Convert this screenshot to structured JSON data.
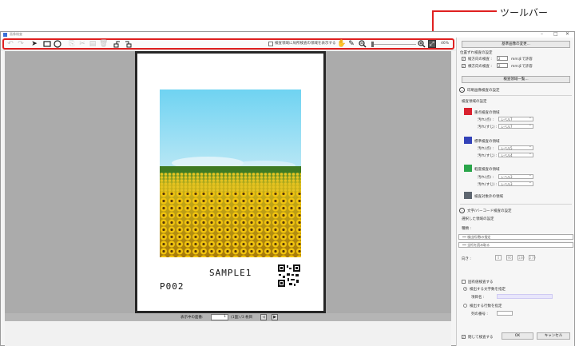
{
  "callout": {
    "label": "ツールバー"
  },
  "window": {
    "title": "画像検査",
    "controls": {
      "minimize": "–",
      "maximize": "□",
      "close": "✕"
    }
  },
  "toolbar": {
    "icons": [
      "undo-icon",
      "redo-icon",
      "select-arrow-icon",
      "rectangle-icon",
      "ellipse-icon",
      "copy-icon",
      "cut-icon",
      "paste-icon",
      "delete-icon",
      "rotate-left-icon",
      "rotate-right-icon"
    ],
    "show_areas_label": "検査領域に局所検査の領域を表示する",
    "zoom_percent": "46%"
  },
  "document": {
    "sample_text": "SAMPLE1",
    "page_code": "P002"
  },
  "pager": {
    "label": "表示中の面番:",
    "current": "1",
    "rest": "(1面) /3 枚目",
    "prev": "◀",
    "next": "▶"
  },
  "panel": {
    "ref_button": "基準画像の変更...",
    "print_pos_heading": "位置ずれ検査の設定",
    "vertical_label": "縦方向の検査 :",
    "vertical_value": "2",
    "horizontal_label": "横方向の検査 :",
    "horizontal_value": "2",
    "unit_suffix": "mmまで許容",
    "list_button": "検査領域一覧...",
    "print_area_heading": "印刷画像検査の設定",
    "color_heading": "検査領域の設定",
    "areas": [
      {
        "name": "重点検査の領域",
        "color": "#d9222f",
        "row1_label": "汚れ(点) :",
        "row1_value": "レベル7",
        "row2_label": "汚れ(すじ) :",
        "row2_value": "レベル7"
      },
      {
        "name": "標準検査の領域",
        "color": "#3342b8",
        "row1_label": "汚れ(点) :",
        "row1_value": "レベル5",
        "row2_label": "汚れ(すじ) :",
        "row2_value": "レベル4"
      },
      {
        "name": "軽度検査の領域",
        "color": "#2aa54a",
        "row1_label": "汚れ(点) :",
        "row1_value": "レベル3",
        "row2_label": "汚れ(すじ) :",
        "row2_value": "レベル3"
      },
      {
        "name": "検査対象外の領域",
        "color": "#5e6670"
      }
    ],
    "barcode_heading": "文字/バーコード検査の設定",
    "selected_region": "選択した領域の設定",
    "type_label": "種類 :",
    "input1": "━━ 検出桁/数の指定",
    "input2": "━━ 全桁を読み取る",
    "direction_label": "向き :",
    "direction_buttons": [
      "0",
      "90",
      "180",
      "270"
    ],
    "unique_check": "固有値検査する",
    "radio1": "検出する文字数を指定",
    "item_label": "項目名 :",
    "radio2": "検出する行数を指定",
    "count_label": "列の番号 :",
    "bottom_check": "閉じて検査する",
    "ok": "OK",
    "cancel": "キャンセル"
  }
}
